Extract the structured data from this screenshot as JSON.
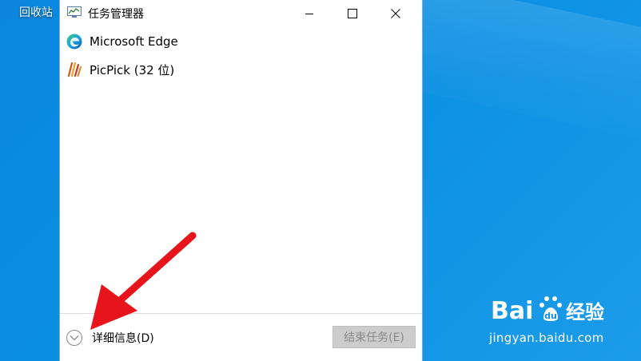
{
  "desktop": {
    "recycle_bin_label": "回收站",
    "background_color": "#0a8fe2"
  },
  "window": {
    "title": "任务管理器",
    "icon": "task-manager-icon",
    "controls": {
      "minimize_icon": "minimize-icon",
      "maximize_icon": "maximize-icon",
      "close_icon": "close-icon"
    },
    "apps": [
      {
        "label": "Microsoft Edge",
        "icon": "edge-icon"
      },
      {
        "label": "PicPick (32 位)",
        "icon": "picpick-icon"
      }
    ],
    "footer": {
      "details_label": "详细信息(D)",
      "details_icon": "chevron-down-icon",
      "end_task_label": "结束任务(E)"
    }
  },
  "annotation": {
    "arrow_color": "#e8141b"
  },
  "watermark": {
    "logo_text": "Baidu经验",
    "url": "jingyan.baidu.com"
  }
}
